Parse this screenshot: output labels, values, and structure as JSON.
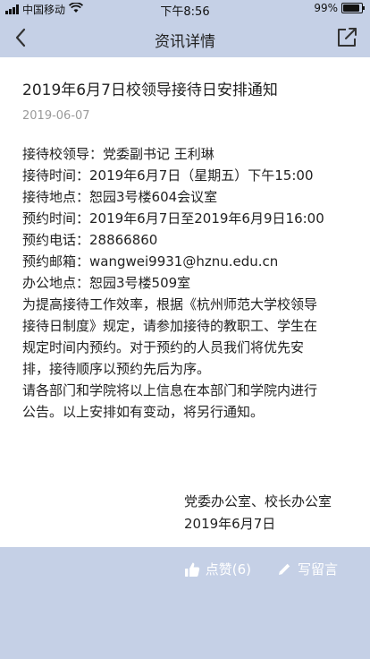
{
  "status": {
    "carrier": "中国移动",
    "time": "下午8:56",
    "battery": "99%",
    "battery_level": 0.99,
    "icons": [
      "signal-icon",
      "wifi-icon",
      "battery-icon"
    ]
  },
  "nav": {
    "title": "资讯详情",
    "back_icon": "chevron-left-icon",
    "share_icon": "external-edit-icon"
  },
  "article": {
    "title": "2019年6月7日校领导接待日安排通知",
    "date": "2019-06-07",
    "lines": [
      "接待校领导：党委副书记 王利琳",
      "接待时间：2019年6月7日（星期五）下午15:00",
      "接待地点：恕园3号楼604会议室",
      "预约时间：2019年6月7日至2019年6月9日16:00",
      "预约电话：28866860",
      "预约邮箱：wangwei9931@hznu.edu.cn",
      "办公地点：恕园3号楼509室",
      "为提高接待工作效率，根据《杭州师范大学校领导",
      "接待日制度》规定，请参加接待的教职工、学生在",
      "规定时间内预约。对于预约的人员我们将优先安",
      "排，接待顺序以预约先后为序。",
      "请各部门和学院将以上信息在本部门和学院内进行",
      "公告。以上安排如有变动，将另行通知。"
    ],
    "signature": "党委办公室、校长办公室",
    "signature_date": "2019年6月7日"
  },
  "actions": {
    "like_label": "点赞(6)",
    "comment_label": "写留言"
  },
  "colors": {
    "bar_bg": "#c5d0e6",
    "content_bg": "#ffffff",
    "date_gray": "#9a9a9a"
  }
}
